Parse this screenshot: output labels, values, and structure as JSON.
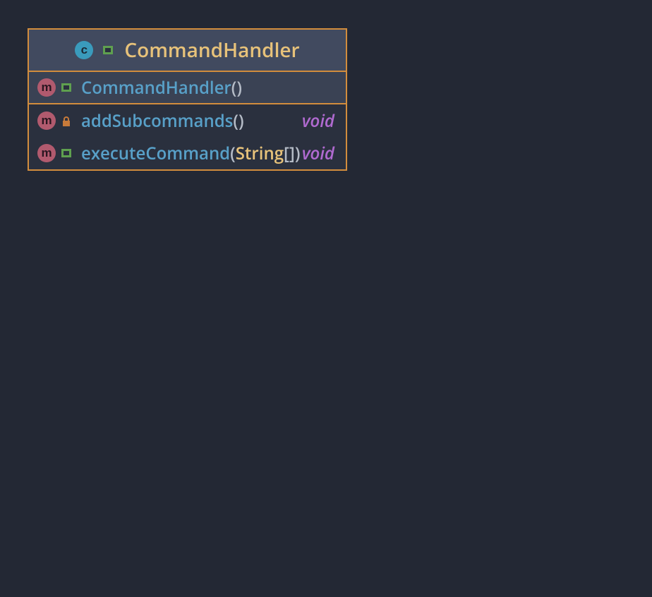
{
  "class": {
    "name": "CommandHandler",
    "icon_label": "c",
    "visibility": "public"
  },
  "members": [
    {
      "kind": "constructor",
      "icon_label": "m",
      "visibility": "public",
      "name": "CommandHandler",
      "params_open": "(",
      "params_close": ")",
      "param_type": "",
      "array_suffix": "",
      "return": ""
    },
    {
      "kind": "method",
      "icon_label": "m",
      "visibility": "private",
      "name": "addSubcommands",
      "params_open": "(",
      "params_close": ")",
      "param_type": "",
      "array_suffix": "",
      "return": "void"
    },
    {
      "kind": "method",
      "icon_label": "m",
      "visibility": "public",
      "name": "executeCommand",
      "params_open": "(",
      "param_type": "String",
      "array_suffix": "[]",
      "params_close": ")",
      "return": "void"
    }
  ]
}
